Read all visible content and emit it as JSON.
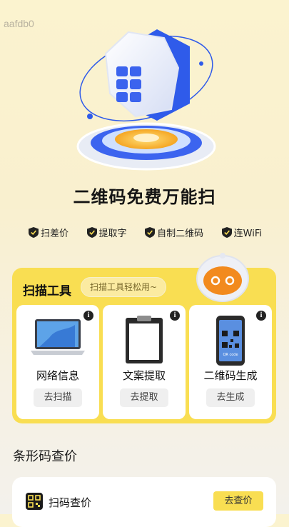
{
  "watermark": "aafdb0",
  "hero": {
    "title": "二维码免费万能扫"
  },
  "features": [
    {
      "label": "扫差价",
      "icon": "check-shield-icon"
    },
    {
      "label": "提取字",
      "icon": "check-shield-icon"
    },
    {
      "label": "自制二维码",
      "icon": "check-shield-icon"
    },
    {
      "label": "连WiFi",
      "icon": "check-shield-icon"
    }
  ],
  "tools": {
    "title": "扫描工具",
    "subtitle": "扫描工具轻松用~",
    "info_glyph": "i",
    "items": [
      {
        "name": "网络信息",
        "button": "去扫描",
        "icon": "laptop-icon"
      },
      {
        "name": "文案提取",
        "button": "去提取",
        "icon": "clipboard-icon"
      },
      {
        "name": "二维码生成",
        "button": "去生成",
        "icon": "phone-qr-icon"
      }
    ],
    "qr_phone_caption": "QR code"
  },
  "barcode": {
    "section_title": "条形码查价",
    "item_label": "扫码查价",
    "item_button": "去查价"
  },
  "colors": {
    "accent": "#f9de52",
    "hero_blue": "#2f5bea",
    "robot_orange": "#f28a1e"
  }
}
